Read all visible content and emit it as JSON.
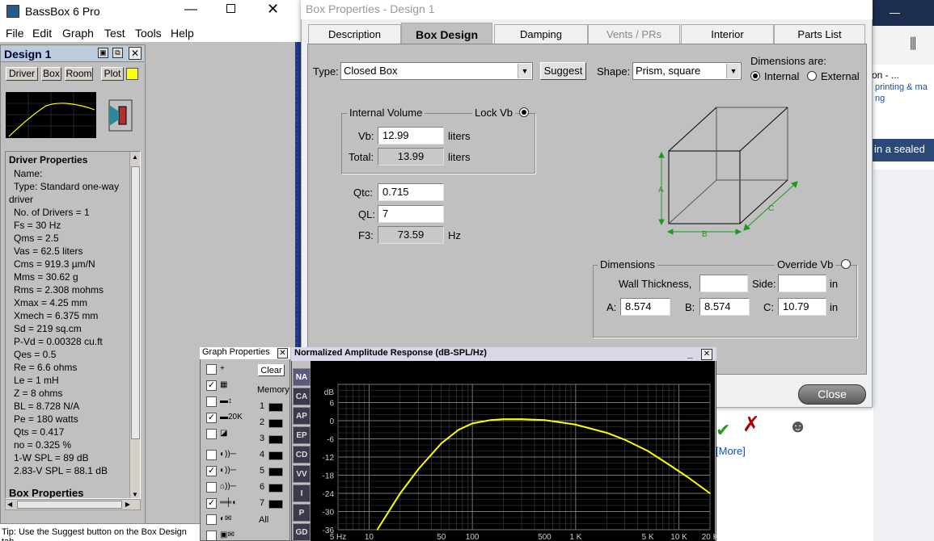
{
  "main_window": {
    "title": "BassBox 6 Pro",
    "menu": [
      "File",
      "Edit",
      "Graph",
      "Test",
      "Tools",
      "Help"
    ]
  },
  "design_panel": {
    "title": "Design 1",
    "buttons": [
      "Driver",
      "Box",
      "Room",
      "Plot"
    ],
    "driver_header": "Driver Properties",
    "driver_lines": [
      "Name:",
      "Type: Standard one-way",
      "driver",
      "No. of Drivers = 1",
      "Fs = 30 Hz",
      "Qms = 2.5",
      "Vas = 62.5 liters",
      "Cms = 919.3 µm/N",
      "Mms = 30.62 g",
      "Rms = 2.308 mohms",
      "Xmax = 4.25 mm",
      "Xmech = 6.375 mm",
      "Sd = 219 sq.cm",
      "P-Vd = 0.00328 cu.ft",
      "Qes = 0.5",
      "Re = 6.6 ohms",
      "Le = 1 mH",
      "Z = 8 ohms",
      "BL = 8.728 N/A",
      "Pe = 180 watts",
      "Qts = 0.417",
      "no = 0.325 %",
      "1-W SPL = 89 dB",
      "2.83-V SPL = 88.1 dB"
    ],
    "box_header": "Box Properties"
  },
  "tip": "Tip: Use the Suggest button on the Box Design tab",
  "dialog": {
    "title": "Box Properties - Design 1",
    "tabs": [
      "Description",
      "Box Design",
      "Damping",
      "Vents / PRs",
      "Interior",
      "Parts List"
    ],
    "type_label": "Type:",
    "type_value": "Closed Box",
    "suggest": "Suggest",
    "shape_label": "Shape:",
    "shape_value": "Prism, square",
    "dims_are": "Dimensions are:",
    "internal": "Internal",
    "external": "External",
    "internal_volume": "Internal Volume",
    "lock_vb": "Lock Vb",
    "vb_label": "Vb:",
    "vb_value": "12.99",
    "liters": "liters",
    "total_label": "Total:",
    "total_value": "13.99",
    "qtc_label": "Qtc:",
    "qtc_value": "0.715",
    "ql_label": "QL:",
    "ql_value": "7",
    "f3_label": "F3:",
    "f3_value": "73.59",
    "hz": "Hz",
    "dimensions": "Dimensions",
    "override_vb": "Override Vb",
    "wall_label": "Wall Thickness,",
    "side_label": "Side:",
    "in": "in",
    "a_label": "A:",
    "a_value": "8.574",
    "b_label": "B:",
    "b_value": "8.574",
    "c_label": "C:",
    "c_value": "10.79",
    "box_a": "A",
    "box_b": "B",
    "box_c": "C",
    "close": "Close"
  },
  "graph_props": {
    "title": "Graph Properties",
    "clear": "Clear",
    "memory": "Memory",
    "mem_nums": [
      "1",
      "2",
      "3",
      "4",
      "5",
      "6",
      "7"
    ],
    "all": "All",
    "zoom_label": "20K"
  },
  "graph": {
    "title": "Normalized Amplitude Response (dB-SPL/Hz)",
    "side_buttons": [
      "NA",
      "CA",
      "AP",
      "EP",
      "CD",
      "VV",
      "I",
      "P",
      "GD"
    ]
  },
  "browser": {
    "text1": "on - ...",
    "text2": "printing & ma",
    "text3": "ng",
    "text4": "in a sealed",
    "more": "[More]"
  },
  "chart_data": {
    "type": "line",
    "title": "Normalized Amplitude Response (dB-SPL/Hz)",
    "ylabel": "dB",
    "ylim": [
      -36,
      12
    ],
    "yticks": [
      6,
      0,
      -6,
      -12,
      -18,
      -24,
      -30,
      -36
    ],
    "xlabel": "Hz",
    "xscale": "log",
    "xlim": [
      5,
      20000
    ],
    "xticks": [
      "5 Hz",
      "10",
      "50",
      "100",
      "500",
      "1 K",
      "5 K",
      "10 K",
      "20 K"
    ],
    "series": [
      {
        "color": "#ffff00",
        "x": [
          12,
          20,
          30,
          50,
          73.59,
          100,
          150,
          200,
          300,
          500,
          700,
          1000,
          2000,
          3000,
          5000,
          8000,
          12000,
          20000
        ],
        "y": [
          -36,
          -24,
          -16,
          -7.5,
          -3,
          -0.9,
          0.2,
          0.5,
          0.5,
          0.2,
          -0.5,
          -1.3,
          -4,
          -6.3,
          -10,
          -14.5,
          -18.5,
          -24
        ]
      }
    ]
  }
}
